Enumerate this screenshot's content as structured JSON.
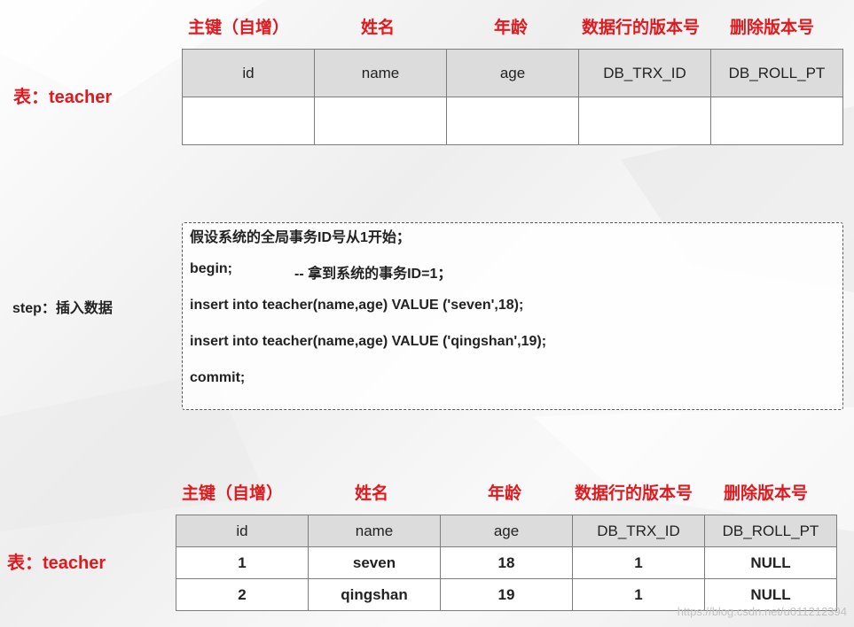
{
  "column_headers": {
    "pk": "主键（自增）",
    "name": "姓名",
    "age": "年龄",
    "row_version": "数据行的版本号",
    "delete_version": "删除版本号"
  },
  "table_label": "表：teacher",
  "columns": [
    "id",
    "name",
    "age",
    "DB_TRX_ID",
    "DB_ROLL_PT"
  ],
  "step_label": "step：插入数据",
  "code": {
    "comment": "假设系统的全局事务ID号从1开始；",
    "begin": "begin;",
    "begin_comment": "--  拿到系统的事务ID=1；",
    "insert1": "insert into teacher(name,age) VALUE ('seven',18);",
    "insert2": "insert into teacher(name,age) VALUE ('qingshan',19);",
    "commit": "commit;"
  },
  "rows": [
    [
      "1",
      "seven",
      "18",
      "1",
      "NULL"
    ],
    [
      "2",
      "qingshan",
      "19",
      "1",
      "NULL"
    ]
  ],
  "watermark": "https://blog.csdn.net/u011212394"
}
